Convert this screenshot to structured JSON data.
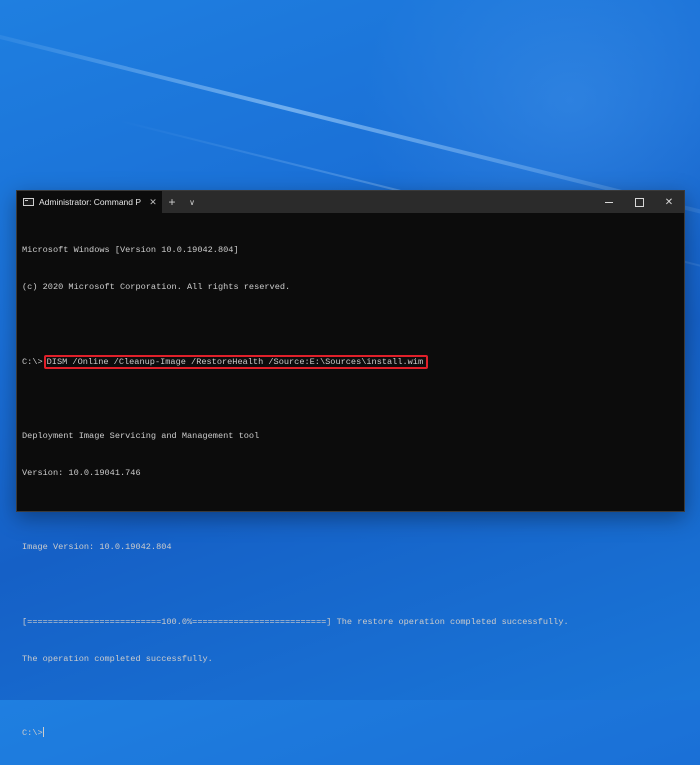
{
  "window": {
    "tab_title": "Administrator: Command Prompt",
    "new_tab_label": "+",
    "dropdown_label": "∨",
    "close_tab_label": "✕",
    "close_label": "✕"
  },
  "console": {
    "line1": "Microsoft Windows [Version 10.0.19042.804]",
    "line2": "(c) 2020 Microsoft Corporation. All rights reserved.",
    "prompt1": "C:\\>",
    "command": "DISM /Online /Cleanup-Image /RestoreHealth /Source:E:\\Sources\\install.wim",
    "line4": "Deployment Image Servicing and Management tool",
    "line5": "Version: 10.0.19041.746",
    "line6": "Image Version: 10.0.19042.804",
    "progress": "[==========================100.0%==========================] The restore operation completed successfully.",
    "line8": "The operation completed successfully.",
    "prompt2": "C:\\>"
  },
  "colors": {
    "highlight": "#e0202a",
    "console_bg": "#0c0c0c",
    "console_text": "#cccccc"
  }
}
